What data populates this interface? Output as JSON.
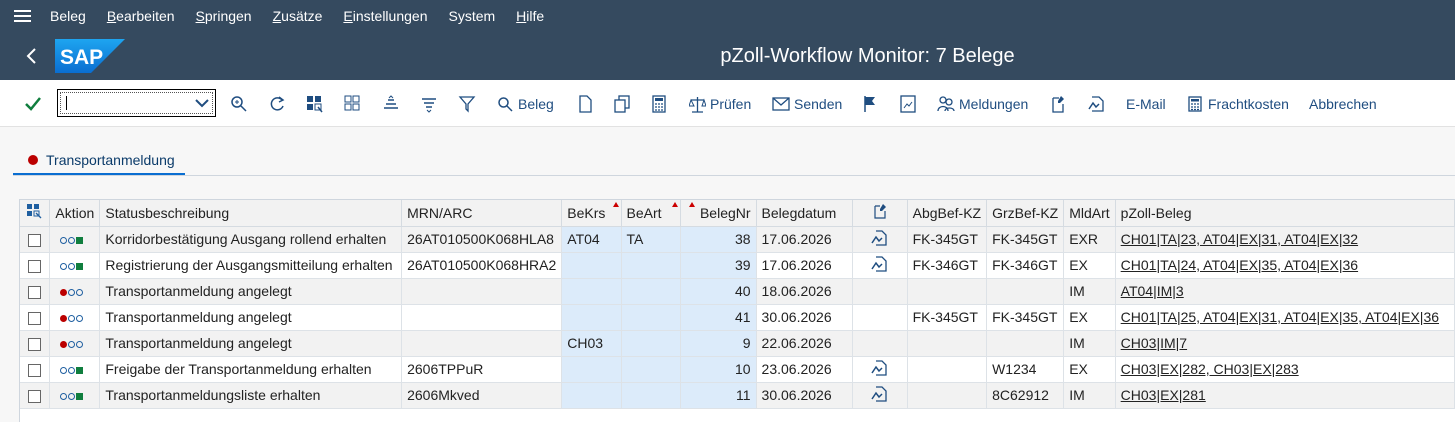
{
  "menu": {
    "items": [
      {
        "pre": "",
        "u": "",
        "rest": "Beleg"
      },
      {
        "pre": "",
        "u": "B",
        "rest": "earbeiten"
      },
      {
        "pre": "",
        "u": "S",
        "rest": "pringen"
      },
      {
        "pre": "",
        "u": "Z",
        "rest": "usätze"
      },
      {
        "pre": "",
        "u": "E",
        "rest": "instellungen"
      },
      {
        "pre": "",
        "u": "",
        "rest": "System"
      },
      {
        "pre": "",
        "u": "H",
        "rest": "ilfe"
      }
    ]
  },
  "title": "pZoll-Workflow Monitor: 7 Belege",
  "toolbar": {
    "command_value": "",
    "beleg_label": "Beleg",
    "pruefen_label": "Prüfen",
    "senden_label": "Senden",
    "meldungen_label": "Meldungen",
    "email_label": "E-Mail",
    "frachtkosten_label": "Frachtkosten",
    "abbrechen_label": "Abbrechen"
  },
  "tab": {
    "label": "Transportanmeldung"
  },
  "grid": {
    "headers": {
      "aktion": "Aktion",
      "status": "Statusbeschreibung",
      "mrn": "MRN/ARC",
      "bekrs": "BeKrs",
      "beart": "BeArt",
      "belegnr": "BelegNr",
      "belegdatum": "Belegdatum",
      "abgbef": "AbgBef-KZ",
      "grzbef": "GrzBef-KZ",
      "mldart": "MldArt",
      "pzoll": "pZoll-Beleg"
    },
    "rows": [
      {
        "action": "green",
        "status": "Korridorbestätigung Ausgang rollend erhalten",
        "mrn": "26AT010500K068HLA8",
        "bekrs": "AT04",
        "beart": "TA",
        "belegnr": "38",
        "belegdatum": "17.06.2026",
        "doc": true,
        "abgbef": "FK-345GT",
        "grzbef": "FK-345GT",
        "mldart": "EXR",
        "pzoll": "CH01|TA|23, AT04|EX|31, AT04|EX|32"
      },
      {
        "action": "green",
        "status": "Registrierung der Ausgangsmitteilung erhalten",
        "mrn": "26AT010500K068HRA2",
        "bekrs": "",
        "beart": "",
        "belegnr": "39",
        "belegdatum": "17.06.2026",
        "doc": true,
        "abgbef": "FK-346GT",
        "grzbef": "FK-346GT",
        "mldart": "EX",
        "pzoll": "CH01|TA|24, AT04|EX|35, AT04|EX|36"
      },
      {
        "action": "red",
        "status": "Transportanmeldung angelegt",
        "mrn": "",
        "bekrs": "",
        "beart": "",
        "belegnr": "40",
        "belegdatum": "18.06.2026",
        "doc": false,
        "abgbef": "",
        "grzbef": "",
        "mldart": "IM",
        "pzoll": "AT04|IM|3"
      },
      {
        "action": "red",
        "status": "Transportanmeldung angelegt",
        "mrn": "",
        "bekrs": "",
        "beart": "",
        "belegnr": "41",
        "belegdatum": "30.06.2026",
        "doc": false,
        "abgbef": "FK-345GT",
        "grzbef": "FK-345GT",
        "mldart": "EX",
        "pzoll": "CH01|TA|25, AT04|EX|31, AT04|EX|35, AT04|EX|36"
      },
      {
        "action": "red",
        "status": "Transportanmeldung angelegt",
        "mrn": "",
        "bekrs": "CH03",
        "beart": "",
        "belegnr": "9",
        "belegdatum": "22.06.2026",
        "doc": false,
        "abgbef": "",
        "grzbef": "",
        "mldart": "IM",
        "pzoll": "CH03|IM|7"
      },
      {
        "action": "green",
        "status": "Freigabe der Transportanmeldung erhalten",
        "mrn": "2606TPPuR",
        "bekrs": "",
        "beart": "",
        "belegnr": "10",
        "belegdatum": "23.06.2026",
        "doc": true,
        "abgbef": "",
        "grzbef": "W1234",
        "mldart": "EX",
        "pzoll": "CH03|EX|282, CH03|EX|283"
      },
      {
        "action": "green",
        "status": "Transportanmeldungsliste erhalten",
        "mrn": "2606Mkved",
        "bekrs": "",
        "beart": "",
        "belegnr": "11",
        "belegdatum": "30.06.2026",
        "doc": true,
        "abgbef": "",
        "grzbef": "8C62912",
        "mldart": "IM",
        "pzoll": "CH03|EX|281"
      }
    ]
  }
}
